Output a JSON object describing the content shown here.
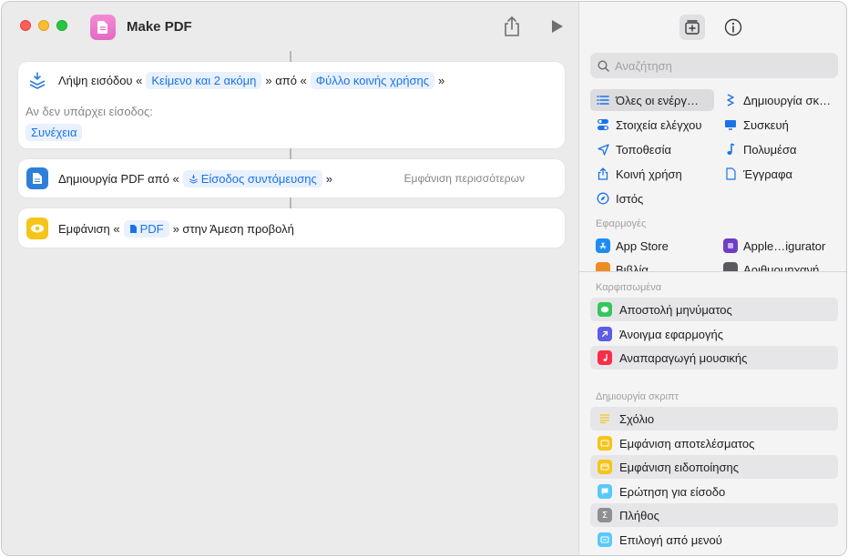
{
  "window": {
    "title": "Make PDF"
  },
  "actions": [
    {
      "pre": "Λήψη εισόδου «",
      "token1": "Κείμενο και 2 ακόμη",
      "mid": "» από «",
      "token2": "Φύλλο κοινής χρήσης",
      "post": "»",
      "no_input_label": "Αν δεν υπάρχει είσοδος:",
      "no_input_value": "Συνέχεια"
    },
    {
      "pre": "Δημιουργία PDF από «",
      "token1": "Είσοδος συντόμευσης",
      "post": "»",
      "more": "Εμφάνιση περισσότερων"
    },
    {
      "pre": "Εμφάνιση «",
      "token1": "PDF",
      "post": "» στην Άμεση προβολή"
    }
  ],
  "sidebar": {
    "search_placeholder": "Αναζήτηση",
    "categories": [
      "Όλες οι ενέργ…",
      "Δημιουργία σκ…",
      "Στοιχεία ελέγχου",
      "Συσκευή",
      "Τοποθεσία",
      "Πολυμέσα",
      "Κοινή χρήση",
      "Έγγραφα",
      "Ιστός"
    ],
    "apps_header": "Εφαρμογές",
    "apps": [
      "App Store",
      "Apple…igurator"
    ],
    "apps_cut": [
      "Βιβλία",
      "Αριθμομηχανή"
    ],
    "pinned_header": "Καρφιτσωμένα",
    "pinned": [
      "Αποστολή μηνύματος",
      "Άνοιγμα εφαρμογής",
      "Αναπαραγωγή μουσικής"
    ],
    "scripting_header": "Δημιουργία σκριπτ",
    "scripting": [
      "Σχόλιο",
      "Εμφάνιση αποτελέσματος",
      "Εμφάνιση ειδοποίησης",
      "Ερώτηση για είσοδο",
      "Πλήθος",
      "Επιλογή από μενού"
    ]
  }
}
